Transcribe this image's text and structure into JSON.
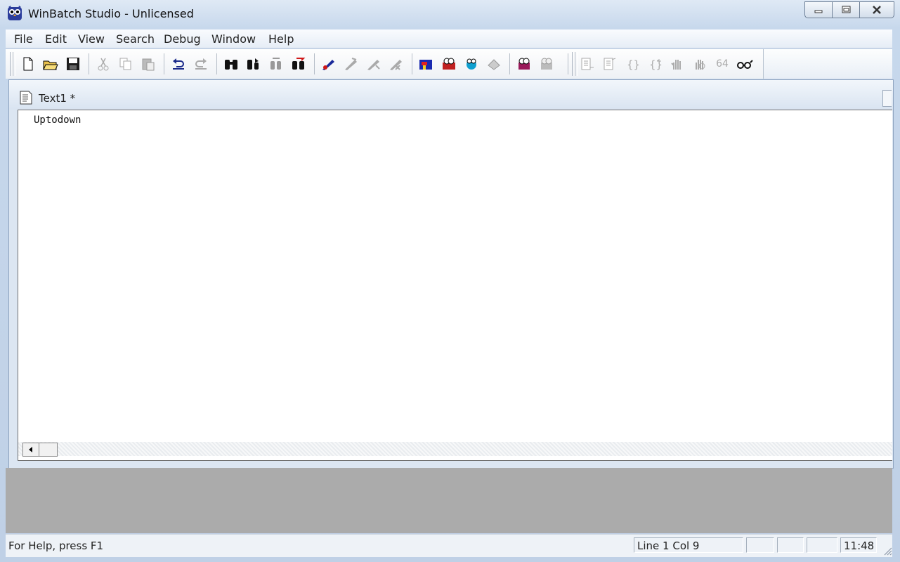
{
  "window": {
    "title": "WinBatch Studio - Unlicensed",
    "app_icon": "owl-icon"
  },
  "menubar": {
    "items": [
      "File",
      "Edit",
      "View",
      "Search",
      "Debug",
      "Window",
      "Help"
    ]
  },
  "toolbar": {
    "buttons": [
      "new-file-icon",
      "open-folder-icon",
      "save-icon",
      "cut-icon",
      "copy-icon",
      "paste-icon",
      "undo-icon",
      "redo-icon",
      "find-icon",
      "find-next-icon",
      "replace-icon",
      "goto-icon",
      "toggle-breakpoint-icon",
      "run-to-cursor-icon",
      "step-icon",
      "step-over-icon",
      "dialog-editor-icon",
      "menu-editor-icon",
      "compile-icon",
      "wizard-icon",
      "debug-run-icon",
      "debug-stop-icon",
      "indent-icon",
      "outdent-icon",
      "brace-icon",
      "brace-match-icon",
      "hand-icon",
      "hand-stop-icon",
      "64bit-label",
      "watch-icon"
    ],
    "label_64": "64"
  },
  "document": {
    "tab_title": "Text1 *",
    "content": "Uptodown"
  },
  "statusbar": {
    "help_text": "For Help, press F1",
    "position": "Line 1 Col 9",
    "time": "11:48"
  }
}
